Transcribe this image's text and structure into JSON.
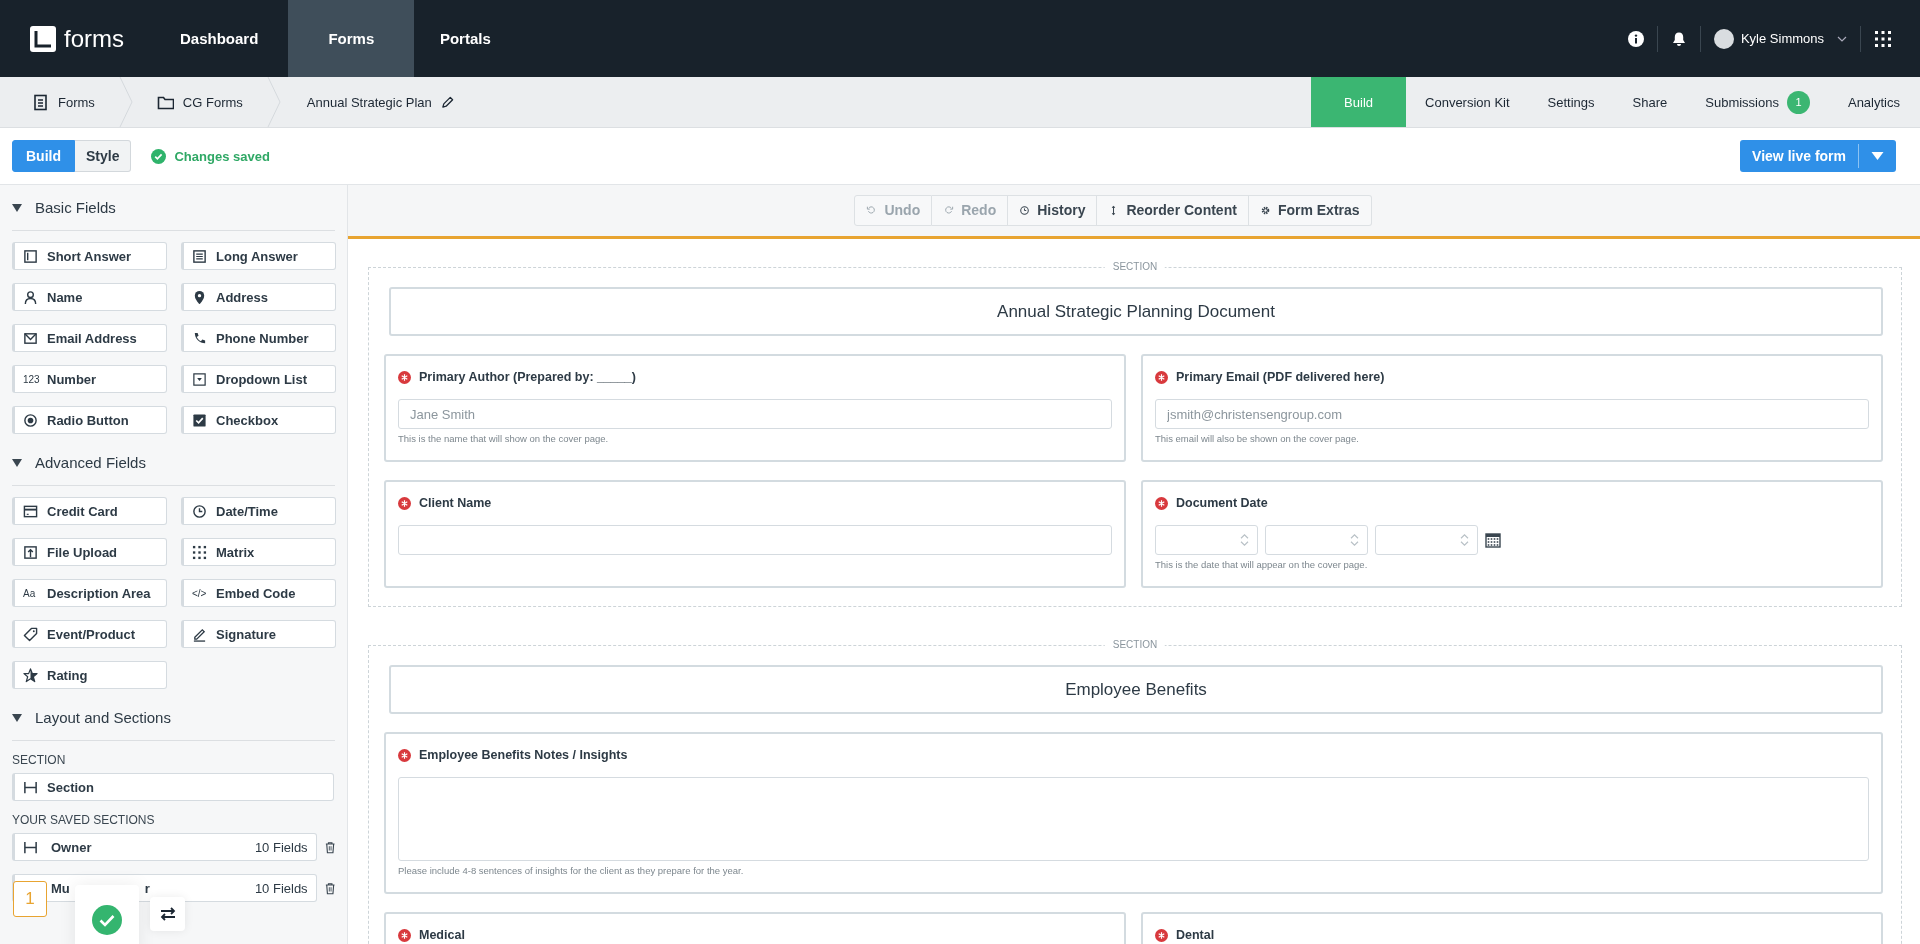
{
  "topbar": {
    "logo": "forms",
    "nav": [
      {
        "label": "Dashboard",
        "selected": false
      },
      {
        "label": "Forms",
        "selected": true
      },
      {
        "label": "Portals",
        "selected": false
      }
    ],
    "user": "Kyle Simmons"
  },
  "breadcrumb": [
    "Forms",
    "CG Forms",
    "Annual Strategic Plan"
  ],
  "form_tabs": [
    {
      "label": "Build",
      "selected": true
    },
    {
      "label": "Conversion Kit",
      "selected": false
    },
    {
      "label": "Settings",
      "selected": false
    },
    {
      "label": "Share",
      "selected": false
    },
    {
      "label": "Submissions",
      "selected": false,
      "badge": "1"
    },
    {
      "label": "Analytics",
      "selected": false
    }
  ],
  "mode_toggle": [
    {
      "label": "Build",
      "selected": true
    },
    {
      "label": "Style",
      "selected": false
    }
  ],
  "save_status": "Changes saved",
  "view_button": "View live form",
  "sidebar": {
    "groups": [
      {
        "title": "Basic Fields",
        "expanded": true,
        "items": [
          {
            "label": "Short Answer"
          },
          {
            "label": "Long Answer"
          },
          {
            "label": "Name"
          },
          {
            "label": "Address"
          },
          {
            "label": "Email Address"
          },
          {
            "label": "Phone Number"
          },
          {
            "label": "Number",
            "icon_text": "123"
          },
          {
            "label": "Dropdown List"
          },
          {
            "label": "Radio Button"
          },
          {
            "label": "Checkbox"
          }
        ]
      },
      {
        "title": "Advanced Fields",
        "expanded": true,
        "items": [
          {
            "label": "Credit Card"
          },
          {
            "label": "Date/Time"
          },
          {
            "label": "File Upload"
          },
          {
            "label": "Matrix"
          },
          {
            "label": "Description Area",
            "icon_text": "Aa"
          },
          {
            "label": "Embed Code",
            "icon_text": "</>"
          },
          {
            "label": "Event/Product"
          },
          {
            "label": "Signature"
          },
          {
            "label": "Rating"
          }
        ]
      },
      {
        "title": "Layout and Sections",
        "expanded": true
      }
    ],
    "section_heading": "SECTION",
    "section_item": "Section",
    "saved_heading": "YOUR SAVED SECTIONS",
    "saved": [
      {
        "name": "Owner",
        "count": "10 Fields"
      },
      {
        "name": "Mu",
        "name_tail": "r",
        "count": "10 Fields"
      }
    ]
  },
  "overlay": {
    "step": "1"
  },
  "toolbar": [
    {
      "label": "Undo",
      "disabled": true
    },
    {
      "label": "Redo",
      "disabled": true
    },
    {
      "label": "History",
      "disabled": false
    },
    {
      "label": "Reorder Content",
      "disabled": false
    },
    {
      "label": "Form Extras",
      "disabled": false
    }
  ],
  "sections": [
    {
      "tag": "SECTION",
      "title": "Annual Strategic Planning Document",
      "rows": [
        [
          {
            "kind": "text",
            "label": "Primary Author (Prepared by: _____)",
            "required": true,
            "placeholder": "Jane Smith",
            "help": "This is the name that will show on the cover page."
          },
          {
            "kind": "text",
            "label": "Primary Email (PDF delivered here)",
            "required": true,
            "placeholder": "jsmith@christensengroup.com",
            "help": "This email will also be shown on the cover page."
          }
        ],
        [
          {
            "kind": "text",
            "label": "Client Name",
            "required": true
          },
          {
            "kind": "date",
            "label": "Document Date",
            "required": true,
            "help": "This is the date that will appear on the cover page."
          }
        ]
      ]
    },
    {
      "tag": "SECTION",
      "title": "Employee Benefits",
      "rows": [
        [
          {
            "kind": "textarea",
            "label": "Employee Benefits Notes / Insights",
            "required": true,
            "help": "Please include 4-8 sentences of insights for the client as they prepare for the year."
          }
        ],
        [
          {
            "kind": "cut",
            "label": "Medical",
            "required": true
          },
          {
            "kind": "cut",
            "label": "Dental",
            "required": true
          }
        ]
      ]
    }
  ]
}
